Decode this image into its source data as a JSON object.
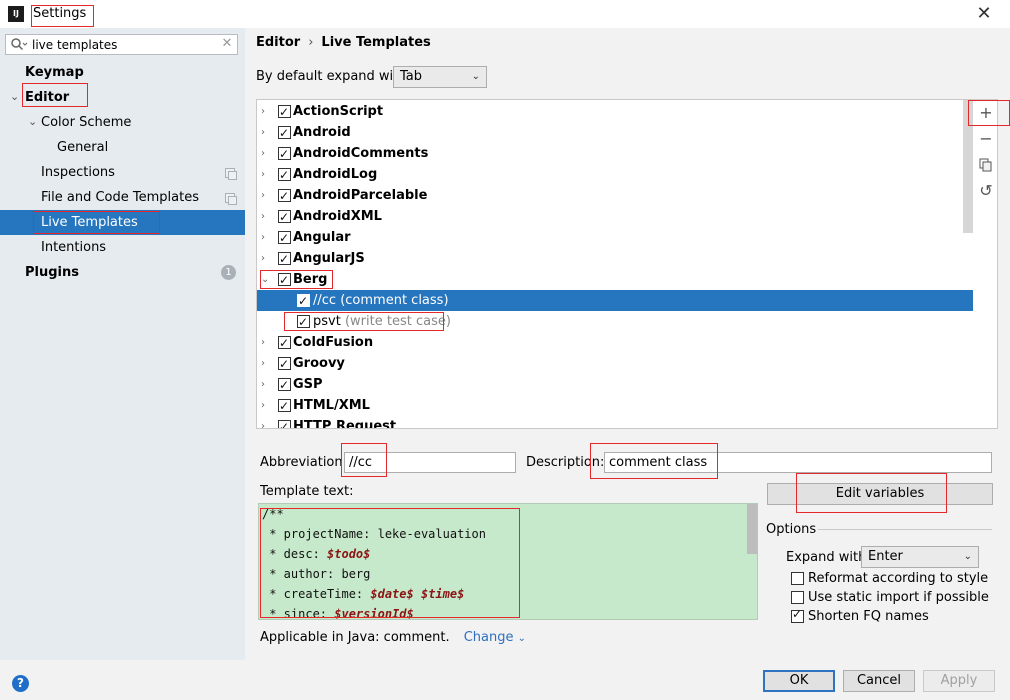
{
  "window": {
    "title": "Settings",
    "app_icon": "intellij-icon",
    "app_icon_text": "IJ",
    "close_icon": "close-icon"
  },
  "search": {
    "value": "live templates",
    "icon": "search-icon",
    "clear_icon": "clear-icon"
  },
  "sidebar": {
    "keymap": "Keymap",
    "editor": "Editor",
    "color_scheme": "Color Scheme",
    "general": "General",
    "inspections": "Inspections",
    "file_code_templates": "File and Code Templates",
    "live_templates": "Live Templates",
    "intentions": "Intentions",
    "plugins": "Plugins",
    "plugins_badge": "1"
  },
  "breadcrumb": {
    "parent": "Editor",
    "separator": "›",
    "current": "Live Templates"
  },
  "expand_default": {
    "label": "By default expand with",
    "value": "Tab"
  },
  "tree": {
    "groups_before": [
      {
        "name": "ActionScript",
        "checked": true
      },
      {
        "name": "Android",
        "checked": true
      },
      {
        "name": "AndroidComments",
        "checked": true
      },
      {
        "name": "AndroidLog",
        "checked": true
      },
      {
        "name": "AndroidParcelable",
        "checked": true
      },
      {
        "name": "AndroidXML",
        "checked": true
      },
      {
        "name": "Angular",
        "checked": true
      },
      {
        "name": "AngularJS",
        "checked": true
      }
    ],
    "expanded_group": {
      "name": "Berg",
      "checked": true,
      "items": [
        {
          "abbr": "//cc",
          "desc": "(comment class)",
          "checked": true,
          "selected": true
        },
        {
          "abbr": "psvt",
          "desc": "(write test case)",
          "checked": true,
          "selected": false
        }
      ]
    },
    "groups_after": [
      {
        "name": "ColdFusion",
        "checked": true
      },
      {
        "name": "Groovy",
        "checked": true
      },
      {
        "name": "GSP",
        "checked": true
      },
      {
        "name": "HTML/XML",
        "checked": true
      },
      {
        "name": "HTTP Request",
        "checked": true
      }
    ]
  },
  "toolbar": {
    "add_icon": "plus-icon",
    "remove_icon": "minus-icon",
    "copy_icon": "copy-icon",
    "restore_icon": "undo-icon"
  },
  "editor": {
    "abbreviation_label": "Abbreviation:",
    "abbreviation_value": "//cc",
    "description_label": "Description:",
    "description_value": "comment class",
    "template_text_label": "Template text:",
    "template_lines": [
      {
        "text": "/**"
      },
      {
        "text": " * projectName: leke-evaluation"
      },
      {
        "text": " * desc: ",
        "var": "$todo$"
      },
      {
        "text": " * author: berg"
      },
      {
        "text": " * createTime: ",
        "var": "$date$",
        "var2": "$time$"
      },
      {
        "text": " * since: ",
        "var": "$versionId$"
      }
    ],
    "edit_variables": "Edit variables",
    "options_label": "Options",
    "expand_with_label": "Expand with",
    "expand_with_value": "Enter",
    "reformat": {
      "label": "Reformat according to style",
      "checked": false
    },
    "static_import": {
      "label": "Use static import if possible",
      "checked": false
    },
    "shorten_fq": {
      "label": "Shorten FQ names",
      "checked": true
    },
    "applicable": "Applicable in Java: comment.",
    "change": "Change"
  },
  "footer": {
    "ok": "OK",
    "cancel": "Cancel",
    "apply": "Apply",
    "help_icon": "help-icon"
  },
  "colors": {
    "selection": "#2675bf",
    "sidebar_bg": "#e6ebf0",
    "template_bg": "#c7e9cb",
    "highlight_box": "#e5292b",
    "link": "#2f6fbd"
  }
}
